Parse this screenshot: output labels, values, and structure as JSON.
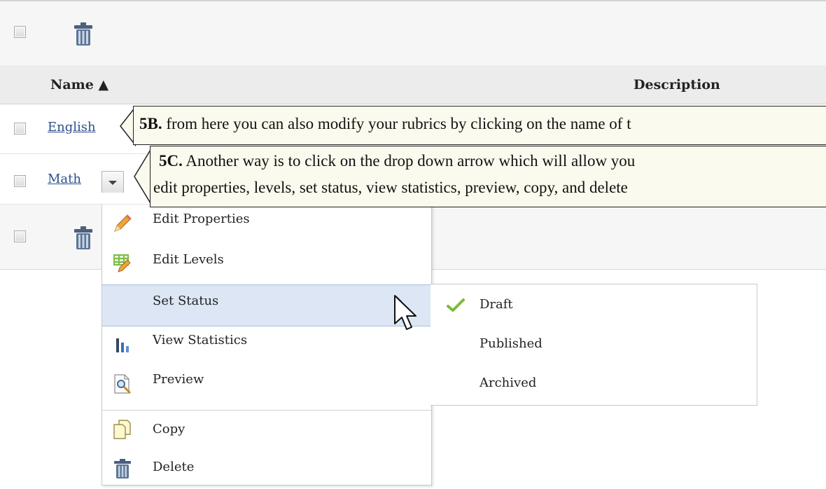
{
  "header": {
    "name": "Name ▲",
    "description": "Description"
  },
  "rows": [
    {
      "name": "English"
    },
    {
      "name": "Math"
    }
  ],
  "callouts": {
    "b": {
      "num": "5B.",
      "text": " from here you can also modify your rubrics by clicking on the name of t"
    },
    "c": {
      "num": "5C.",
      "line1": " Another way is to click on the drop down arrow which will allow you",
      "line2": "edit properties, levels, set status, view statistics, preview, copy, and delete"
    }
  },
  "menu": {
    "items": [
      {
        "label": "Edit Properties",
        "icon": "pencil-icon"
      },
      {
        "label": "Edit Levels",
        "icon": "grid-pencil-icon"
      },
      {
        "label": "Set Status",
        "icon": ""
      },
      {
        "label": "View Statistics",
        "icon": "bar-chart-icon"
      },
      {
        "label": "Preview",
        "icon": "magnifier-page-icon"
      },
      {
        "label": "Copy",
        "icon": "copy-icon"
      },
      {
        "label": "Delete",
        "icon": "trash-icon"
      }
    ]
  },
  "submenu": {
    "items": [
      {
        "label": "Draft",
        "checked": true
      },
      {
        "label": "Published",
        "checked": false
      },
      {
        "label": "Archived",
        "checked": false
      }
    ]
  },
  "colors": {
    "link": "#2b4f8c",
    "highlight": "#dce6f4",
    "callout_bg": "#fbfaee",
    "check": "#7dbb3a"
  }
}
